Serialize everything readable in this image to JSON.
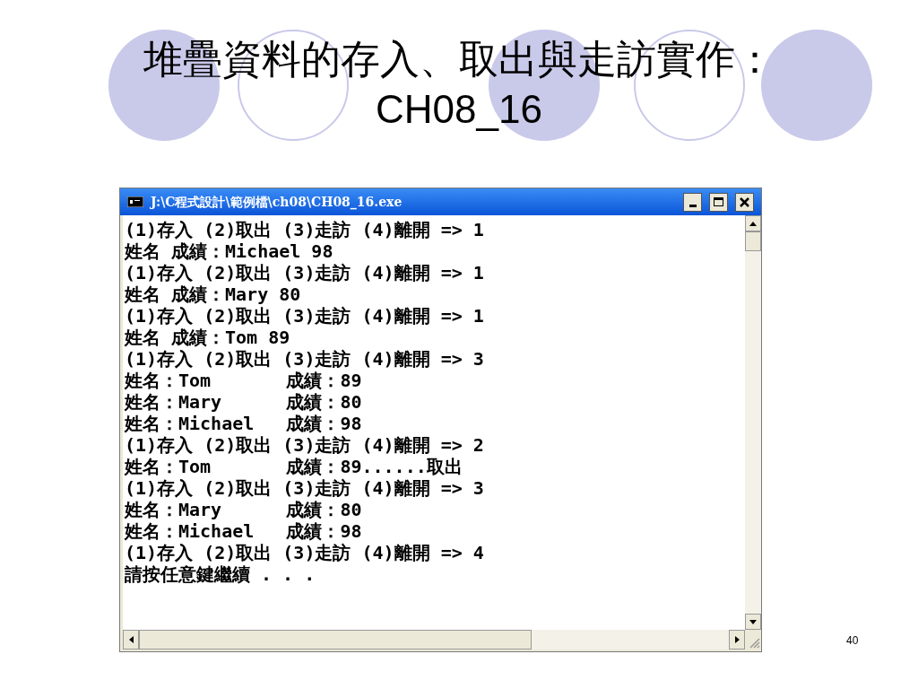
{
  "slide": {
    "title": "堆疊資料的存入、取出與走訪實作：",
    "subtitle": "CH08_16",
    "page_number": "40"
  },
  "window": {
    "title": "J:\\C程式設計\\範例檔\\ch08\\CH08_16.exe"
  },
  "console": {
    "lines": [
      "(1)存入 (2)取出 (3)走訪 (4)離開 => 1",
      "姓名 成績：Michael 98",
      "(1)存入 (2)取出 (3)走訪 (4)離開 => 1",
      "姓名 成績：Mary 80",
      "(1)存入 (2)取出 (3)走訪 (4)離開 => 1",
      "姓名 成績：Tom 89",
      "(1)存入 (2)取出 (3)走訪 (4)離開 => 3",
      "姓名：Tom       成績：89",
      "姓名：Mary      成績：80",
      "姓名：Michael   成績：98",
      "(1)存入 (2)取出 (3)走訪 (4)離開 => 2",
      "姓名：Tom       成績：89......取出",
      "(1)存入 (2)取出 (3)走訪 (4)離開 => 3",
      "姓名：Mary      成績：80",
      "姓名：Michael   成績：98",
      "(1)存入 (2)取出 (3)走訪 (4)離開 => 4",
      "請按任意鍵繼續 . . ."
    ]
  }
}
